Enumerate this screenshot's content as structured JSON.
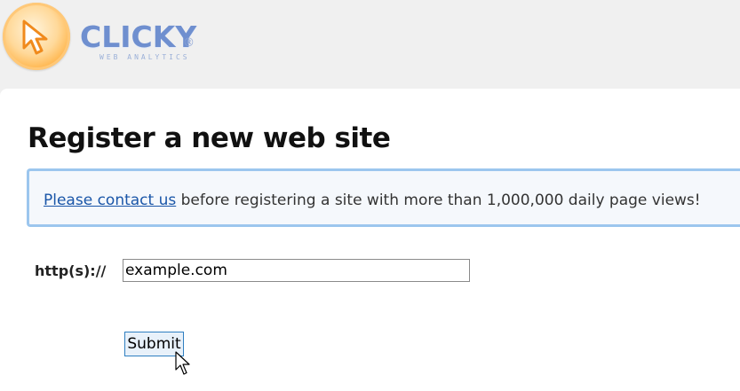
{
  "brand": {
    "name": "CLICKY",
    "registered_mark": "®",
    "tagline": "WEB ANALYTICS"
  },
  "page": {
    "title": "Register a new web site"
  },
  "notice": {
    "link_text": "Please contact us",
    "message": " before registering a site with more than 1,000,000 daily page views!"
  },
  "form": {
    "protocol_label": "http(s)://",
    "url_value": "example.com",
    "submit_label": "Submit"
  },
  "colors": {
    "link": "#1a56a8",
    "notice_border": "#9cc6ee",
    "logo_orange": "#ffb347"
  }
}
